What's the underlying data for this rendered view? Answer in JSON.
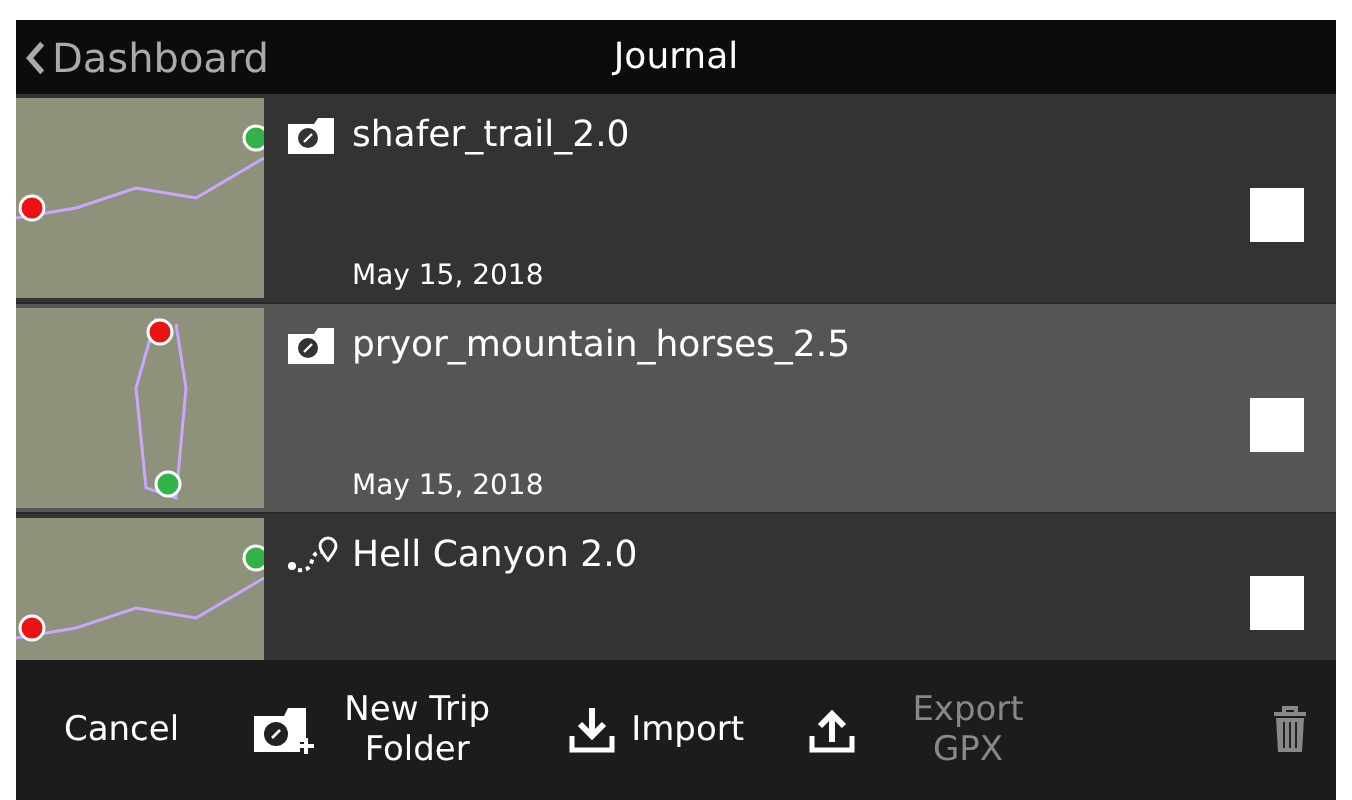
{
  "header": {
    "back_label": "Dashboard",
    "title": "Journal"
  },
  "entries": [
    {
      "kind": "folder",
      "title": "shafer_trail_2.0",
      "date": "May 15, 2018",
      "selected": false,
      "checked": false
    },
    {
      "kind": "folder",
      "title": "pryor_mountain_horses_2.5",
      "date": "May 15, 2018",
      "selected": true,
      "checked": false
    },
    {
      "kind": "trip",
      "title": "Hell Canyon 2.0",
      "selected": false,
      "checked": false
    }
  ],
  "toolbar": [
    {
      "kind": "cancel",
      "label": "Cancel",
      "disabled": false
    },
    {
      "kind": "new-folder",
      "label": "New Trip Folder",
      "disabled": false
    },
    {
      "kind": "import",
      "label": "Import",
      "disabled": false
    },
    {
      "kind": "export",
      "label": "Export GPX",
      "disabled": true
    },
    {
      "kind": "trash",
      "disabled": true
    }
  ]
}
